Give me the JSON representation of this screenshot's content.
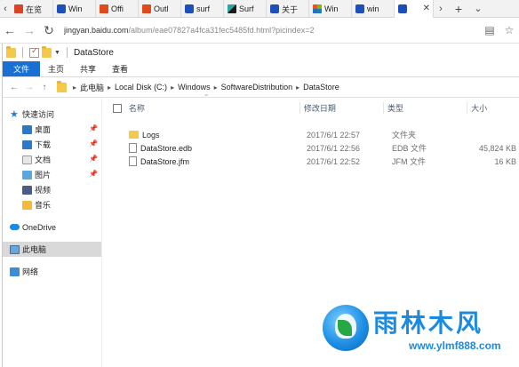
{
  "browser": {
    "tabs": [
      {
        "label": "在览",
        "favicon": "red-favicon"
      },
      {
        "label": "Win",
        "favicon": "paw-favicon"
      },
      {
        "label": "Offi",
        "favicon": "office-favicon"
      },
      {
        "label": "Outl",
        "favicon": "office-favicon"
      },
      {
        "label": "surf",
        "favicon": "paw-favicon"
      },
      {
        "label": "Surf",
        "favicon": "surface-favicon"
      },
      {
        "label": "关于",
        "favicon": "paw-favicon"
      },
      {
        "label": "Win",
        "favicon": "windows-favicon"
      },
      {
        "label": "win",
        "favicon": "paw-favicon"
      },
      {
        "label": "",
        "favicon": "paw-favicon"
      }
    ],
    "url_host": "jingyan.baidu.com",
    "url_path": "/album/eae07827a4fca31fec5485fd.html?picindex=2"
  },
  "explorer": {
    "title": "DataStore",
    "ribbon_tabs": [
      "文件",
      "主页",
      "共享",
      "查看"
    ],
    "breadcrumb": [
      "此电脑",
      "Local Disk (C:)",
      "Windows",
      "SoftwareDistribution",
      "DataStore"
    ],
    "nav": {
      "quick_access": "快速访问",
      "items": [
        "桌面",
        "下载",
        "文档",
        "图片",
        "视频",
        "音乐"
      ],
      "onedrive": "OneDrive",
      "this_pc": "此电脑",
      "network": "网络"
    },
    "columns": {
      "name": "名称",
      "date": "修改日期",
      "type": "类型",
      "size": "大小"
    },
    "files": [
      {
        "name": "Logs",
        "date": "2017/6/1 22:57",
        "type": "文件夹",
        "size": ""
      },
      {
        "name": "DataStore.edb",
        "date": "2017/6/1 22:56",
        "type": "EDB 文件",
        "size": "45,824 KB"
      },
      {
        "name": "DataStore.jfm",
        "date": "2017/6/1 22:52",
        "type": "JFM 文件",
        "size": "16 KB"
      }
    ]
  },
  "watermark": {
    "title": "雨林木风",
    "url": "www.ylmf888.com"
  }
}
